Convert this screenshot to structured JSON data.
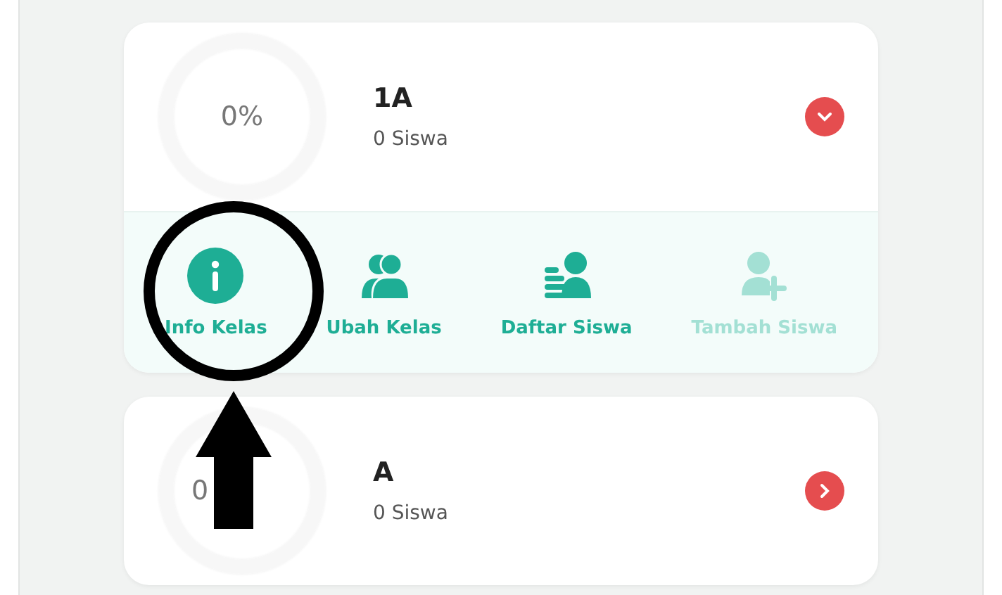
{
  "classes": [
    {
      "percent": "0%",
      "name": "1A",
      "students": "0 Siswa",
      "expanded": true,
      "actions": [
        {
          "kind": "info",
          "label": "Info Kelas",
          "disabled": false
        },
        {
          "kind": "edit",
          "label": "Ubah Kelas",
          "disabled": false
        },
        {
          "kind": "list",
          "label": "Daftar Siswa",
          "disabled": false
        },
        {
          "kind": "add",
          "label": "Tambah Siswa",
          "disabled": true
        }
      ]
    },
    {
      "percent": "0",
      "name": "A",
      "students": "0 Siswa",
      "expanded": false
    }
  ]
}
